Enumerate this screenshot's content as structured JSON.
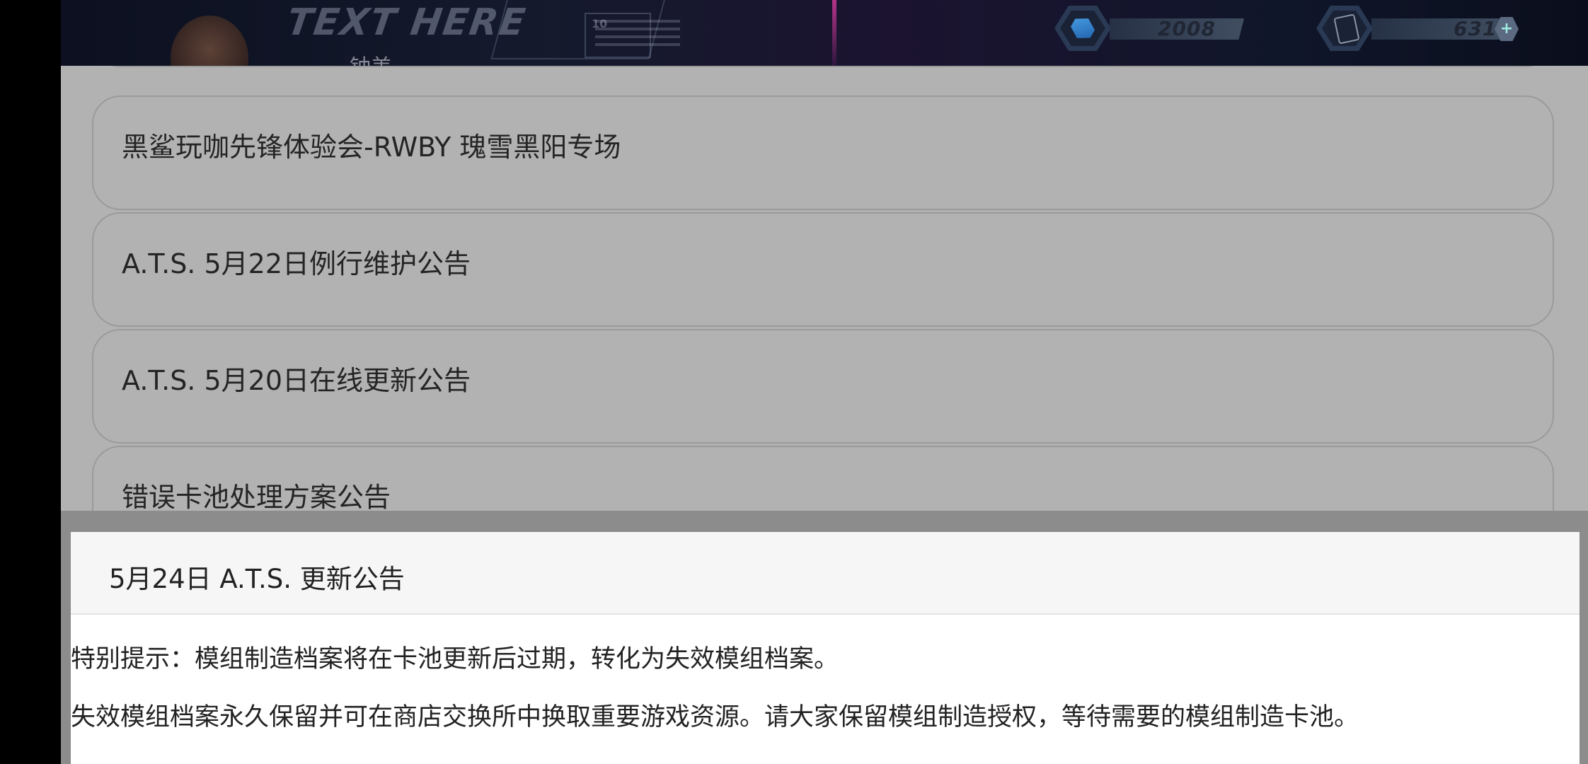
{
  "header": {
    "bg_logo_text": "TEXT HERE",
    "bg_panel_text": "10",
    "bg_subtitle": "钟美",
    "resources": [
      {
        "name": "crystal",
        "icon": "crystal-gem-icon",
        "value": "2008"
      },
      {
        "name": "card",
        "icon": "card-icon",
        "value": "631",
        "has_plus": true
      }
    ],
    "close_icon": "close-x-icon",
    "close_glyph": "✕"
  },
  "announcements": {
    "items": [
      {
        "label": ""
      },
      {
        "label": "黑鲨玩咖先锋体验会-RWBY 瑰雪黑阳专场"
      },
      {
        "label": "A.T.S. 5月22日例行维护公告"
      },
      {
        "label": "A.T.S. 5月20日在线更新公告"
      },
      {
        "label": "错误卡池处理方案公告"
      }
    ]
  },
  "detail": {
    "title": "5月24日 A.T.S. 更新公告",
    "paragraphs": [
      "特别提示：模组制造档案将在卡池更新后过期，转化为失效模组档案。",
      "失效模组档案永久保留并可在商店交换所中换取重要游戏资源。请大家保留模组制造授权，等待需要的模组制造卡池。"
    ]
  },
  "colors": {
    "list_bg": "#b2b2b2",
    "item_border": "#9a9a9a",
    "close_accent": "#38e0e8",
    "detail_header_bg": "#f6f6f6"
  }
}
